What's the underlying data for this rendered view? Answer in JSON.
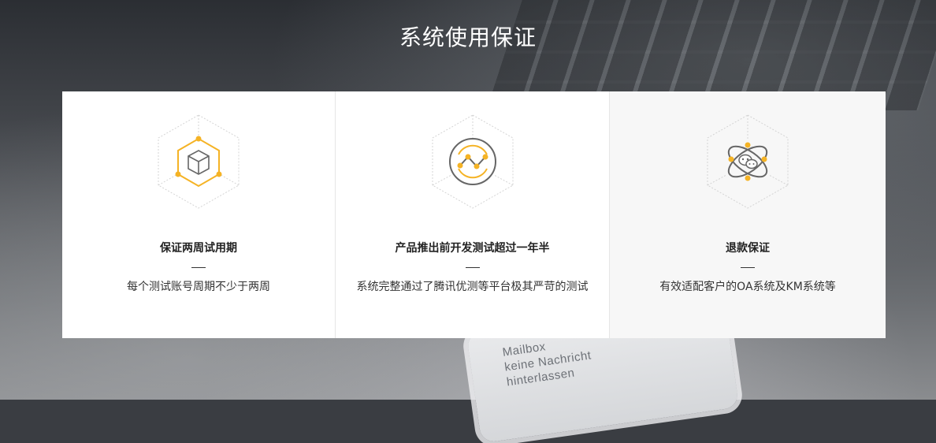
{
  "section": {
    "title": "系统使用保证"
  },
  "cards": [
    {
      "icon": "cube-icon",
      "title": "保证两周试用期",
      "desc": "每个测试账号周期不少于两周"
    },
    {
      "icon": "trend-chart-icon",
      "title": "产品推出前开发测试超过一年半",
      "desc": "系统完整通过了腾讯优测等平台极其严苛的测试"
    },
    {
      "icon": "chat-orbit-icon",
      "title": "退款保证",
      "desc": "有效适配客户的OA系统及KM系统等"
    }
  ],
  "background": {
    "phone_text": [
      "Mailbox",
      "keine Nachricht",
      "hinterlassen"
    ]
  },
  "colors": {
    "accent": "#f5b325",
    "icon_stroke": "#666666",
    "card_bg": "#ffffff",
    "card_bg_highlight": "#f7f7f7"
  }
}
